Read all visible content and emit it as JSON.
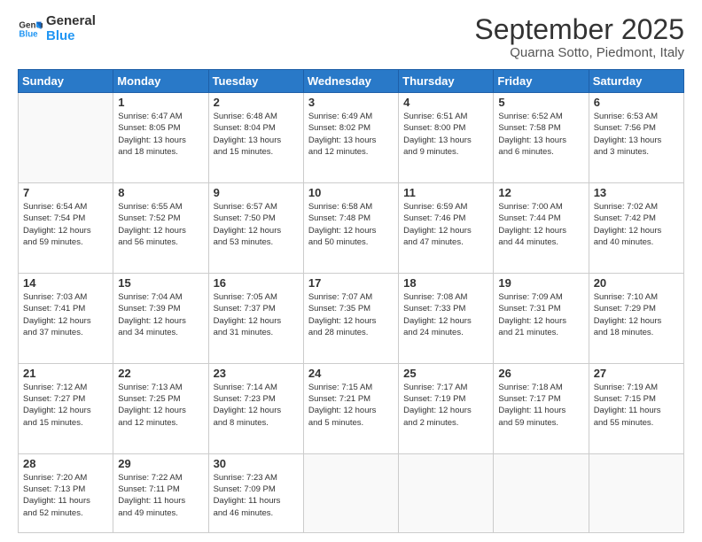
{
  "logo": {
    "line1": "General",
    "line2": "Blue"
  },
  "title": "September 2025",
  "subtitle": "Quarna Sotto, Piedmont, Italy",
  "days_header": [
    "Sunday",
    "Monday",
    "Tuesday",
    "Wednesday",
    "Thursday",
    "Friday",
    "Saturday"
  ],
  "weeks": [
    [
      {
        "day": "",
        "info": ""
      },
      {
        "day": "1",
        "info": "Sunrise: 6:47 AM\nSunset: 8:05 PM\nDaylight: 13 hours\nand 18 minutes."
      },
      {
        "day": "2",
        "info": "Sunrise: 6:48 AM\nSunset: 8:04 PM\nDaylight: 13 hours\nand 15 minutes."
      },
      {
        "day": "3",
        "info": "Sunrise: 6:49 AM\nSunset: 8:02 PM\nDaylight: 13 hours\nand 12 minutes."
      },
      {
        "day": "4",
        "info": "Sunrise: 6:51 AM\nSunset: 8:00 PM\nDaylight: 13 hours\nand 9 minutes."
      },
      {
        "day": "5",
        "info": "Sunrise: 6:52 AM\nSunset: 7:58 PM\nDaylight: 13 hours\nand 6 minutes."
      },
      {
        "day": "6",
        "info": "Sunrise: 6:53 AM\nSunset: 7:56 PM\nDaylight: 13 hours\nand 3 minutes."
      }
    ],
    [
      {
        "day": "7",
        "info": "Sunrise: 6:54 AM\nSunset: 7:54 PM\nDaylight: 12 hours\nand 59 minutes."
      },
      {
        "day": "8",
        "info": "Sunrise: 6:55 AM\nSunset: 7:52 PM\nDaylight: 12 hours\nand 56 minutes."
      },
      {
        "day": "9",
        "info": "Sunrise: 6:57 AM\nSunset: 7:50 PM\nDaylight: 12 hours\nand 53 minutes."
      },
      {
        "day": "10",
        "info": "Sunrise: 6:58 AM\nSunset: 7:48 PM\nDaylight: 12 hours\nand 50 minutes."
      },
      {
        "day": "11",
        "info": "Sunrise: 6:59 AM\nSunset: 7:46 PM\nDaylight: 12 hours\nand 47 minutes."
      },
      {
        "day": "12",
        "info": "Sunrise: 7:00 AM\nSunset: 7:44 PM\nDaylight: 12 hours\nand 44 minutes."
      },
      {
        "day": "13",
        "info": "Sunrise: 7:02 AM\nSunset: 7:42 PM\nDaylight: 12 hours\nand 40 minutes."
      }
    ],
    [
      {
        "day": "14",
        "info": "Sunrise: 7:03 AM\nSunset: 7:41 PM\nDaylight: 12 hours\nand 37 minutes."
      },
      {
        "day": "15",
        "info": "Sunrise: 7:04 AM\nSunset: 7:39 PM\nDaylight: 12 hours\nand 34 minutes."
      },
      {
        "day": "16",
        "info": "Sunrise: 7:05 AM\nSunset: 7:37 PM\nDaylight: 12 hours\nand 31 minutes."
      },
      {
        "day": "17",
        "info": "Sunrise: 7:07 AM\nSunset: 7:35 PM\nDaylight: 12 hours\nand 28 minutes."
      },
      {
        "day": "18",
        "info": "Sunrise: 7:08 AM\nSunset: 7:33 PM\nDaylight: 12 hours\nand 24 minutes."
      },
      {
        "day": "19",
        "info": "Sunrise: 7:09 AM\nSunset: 7:31 PM\nDaylight: 12 hours\nand 21 minutes."
      },
      {
        "day": "20",
        "info": "Sunrise: 7:10 AM\nSunset: 7:29 PM\nDaylight: 12 hours\nand 18 minutes."
      }
    ],
    [
      {
        "day": "21",
        "info": "Sunrise: 7:12 AM\nSunset: 7:27 PM\nDaylight: 12 hours\nand 15 minutes."
      },
      {
        "day": "22",
        "info": "Sunrise: 7:13 AM\nSunset: 7:25 PM\nDaylight: 12 hours\nand 12 minutes."
      },
      {
        "day": "23",
        "info": "Sunrise: 7:14 AM\nSunset: 7:23 PM\nDaylight: 12 hours\nand 8 minutes."
      },
      {
        "day": "24",
        "info": "Sunrise: 7:15 AM\nSunset: 7:21 PM\nDaylight: 12 hours\nand 5 minutes."
      },
      {
        "day": "25",
        "info": "Sunrise: 7:17 AM\nSunset: 7:19 PM\nDaylight: 12 hours\nand 2 minutes."
      },
      {
        "day": "26",
        "info": "Sunrise: 7:18 AM\nSunset: 7:17 PM\nDaylight: 11 hours\nand 59 minutes."
      },
      {
        "day": "27",
        "info": "Sunrise: 7:19 AM\nSunset: 7:15 PM\nDaylight: 11 hours\nand 55 minutes."
      }
    ],
    [
      {
        "day": "28",
        "info": "Sunrise: 7:20 AM\nSunset: 7:13 PM\nDaylight: 11 hours\nand 52 minutes."
      },
      {
        "day": "29",
        "info": "Sunrise: 7:22 AM\nSunset: 7:11 PM\nDaylight: 11 hours\nand 49 minutes."
      },
      {
        "day": "30",
        "info": "Sunrise: 7:23 AM\nSunset: 7:09 PM\nDaylight: 11 hours\nand 46 minutes."
      },
      {
        "day": "",
        "info": ""
      },
      {
        "day": "",
        "info": ""
      },
      {
        "day": "",
        "info": ""
      },
      {
        "day": "",
        "info": ""
      }
    ]
  ]
}
